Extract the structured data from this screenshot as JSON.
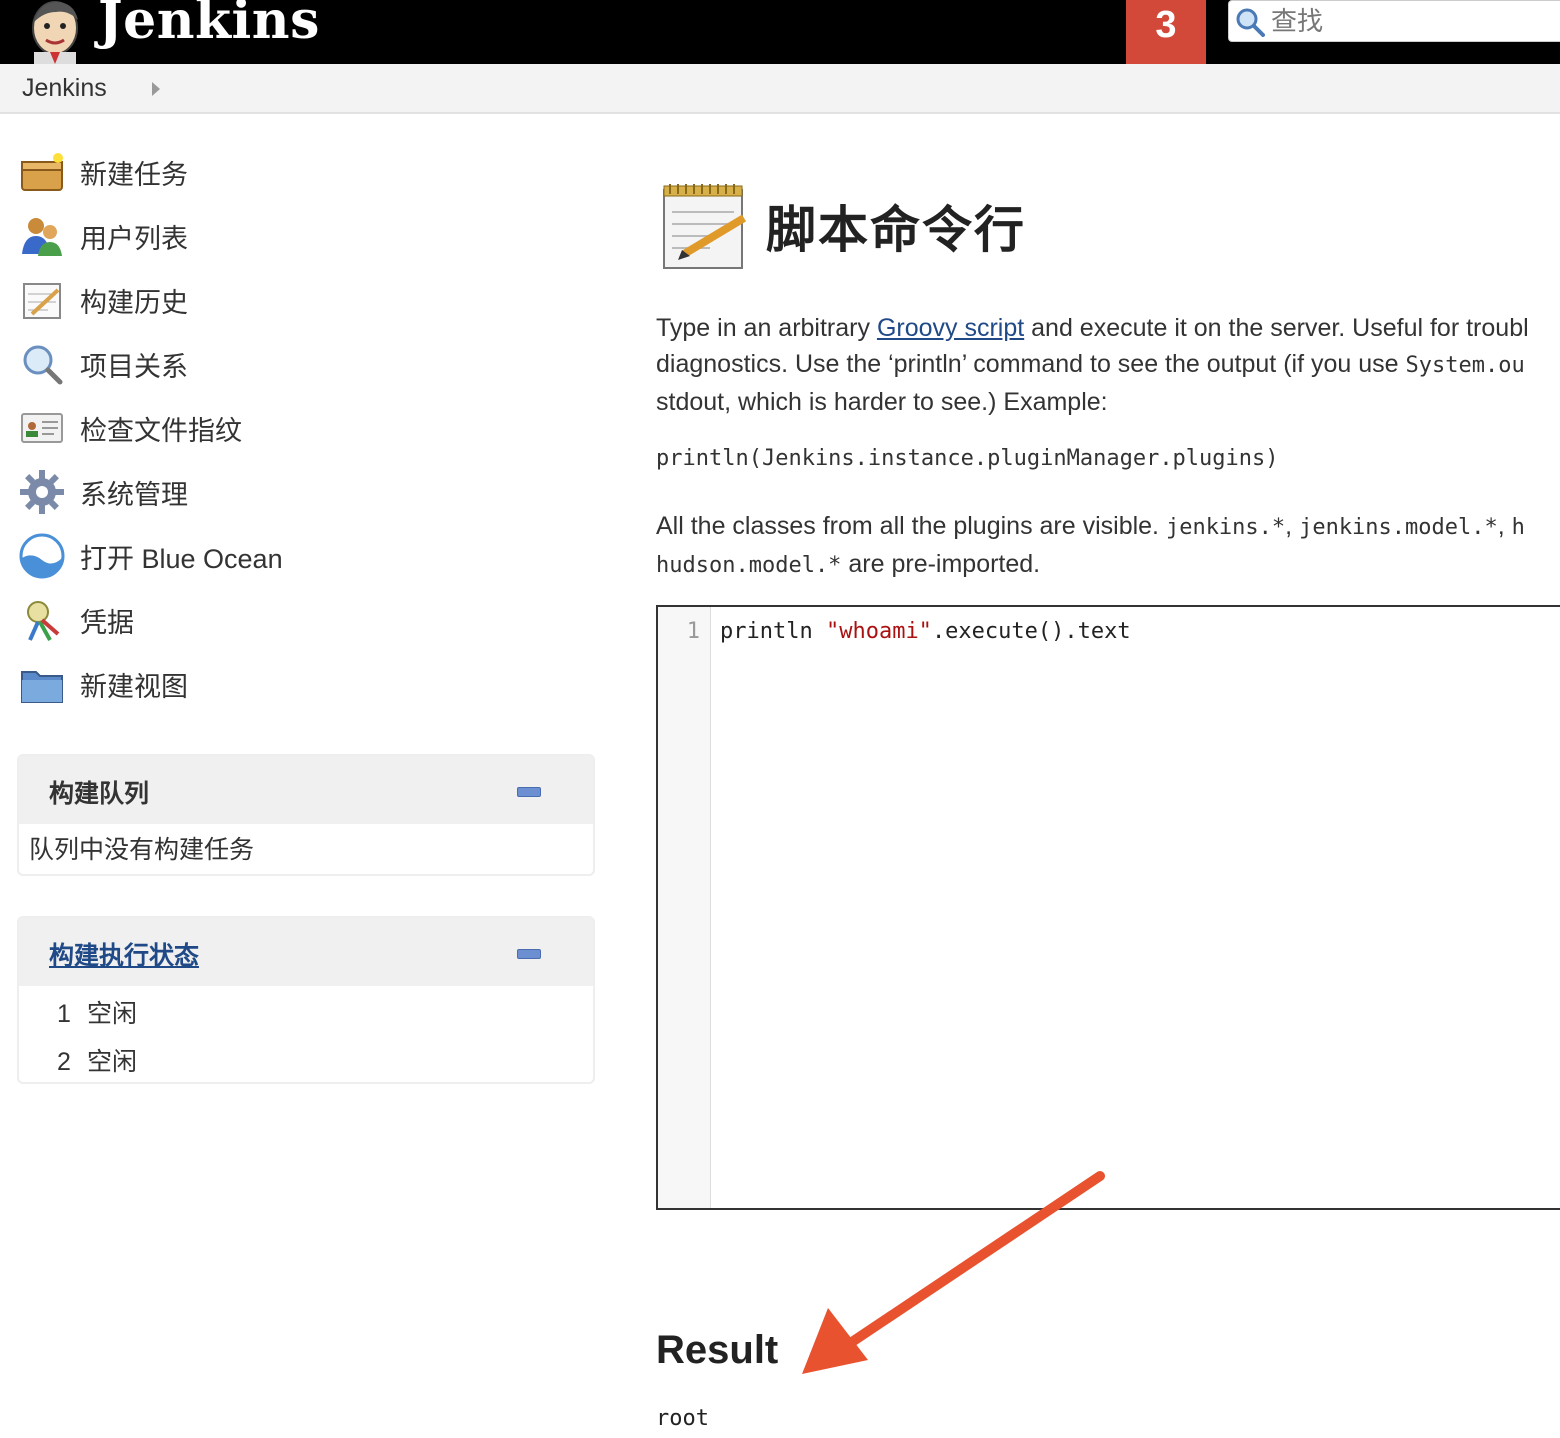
{
  "header": {
    "brand": "Jenkins",
    "notification_count": "3",
    "search_placeholder": "查找"
  },
  "breadcrumb": {
    "items": [
      "Jenkins"
    ]
  },
  "sidebar": {
    "tasks": [
      {
        "label": "新建任务",
        "icon": "new-item-icon"
      },
      {
        "label": "用户列表",
        "icon": "people-icon"
      },
      {
        "label": "构建历史",
        "icon": "notepad-icon"
      },
      {
        "label": "项目关系",
        "icon": "search-icon"
      },
      {
        "label": "检查文件指纹",
        "icon": "fingerprint-icon"
      },
      {
        "label": "系统管理",
        "icon": "gear-icon"
      },
      {
        "label": "打开 Blue Ocean",
        "icon": "blue-ocean-icon"
      },
      {
        "label": "凭据",
        "icon": "credentials-icon"
      },
      {
        "label": "新建视图",
        "icon": "folder-icon"
      }
    ]
  },
  "build_queue": {
    "title": "构建队列",
    "empty_text": "队列中没有构建任务"
  },
  "executors": {
    "title": "构建执行状态",
    "rows": [
      {
        "num": "1",
        "status": "空闲"
      },
      {
        "num": "2",
        "status": "空闲"
      }
    ]
  },
  "main": {
    "title": "脚本命令行",
    "desc_part1": "Type in an arbitrary ",
    "desc_link": "Groovy script",
    "desc_part2": " and execute it on the server. Useful for troubl",
    "desc_line2a": "diagnostics. Use the ‘println’ command to see the output (if you use ",
    "desc_line2_code": "System.ou",
    "desc_line3": "stdout, which is harder to see.) Example:",
    "example": "println(Jenkins.instance.pluginManager.plugins)",
    "classes_part1": "All the classes from all the plugins are visible. ",
    "classes_code1": "jenkins.*",
    "classes_sep1": ", ",
    "classes_code2": "jenkins.model.*",
    "classes_sep2": ", ",
    "classes_code3": "h",
    "classes_code4": "hudson.model.*",
    "classes_part2": " are pre-imported."
  },
  "editor": {
    "line_number": "1",
    "code_prefix": "println ",
    "code_string": "\"whoami\"",
    "code_suffix": ".execute().text"
  },
  "result": {
    "title": "Result",
    "output": "root"
  },
  "colors": {
    "header_bg": "#000000",
    "notification_bg": "#d24939",
    "link": "#204a87",
    "annotation_arrow": "#e8522f"
  }
}
